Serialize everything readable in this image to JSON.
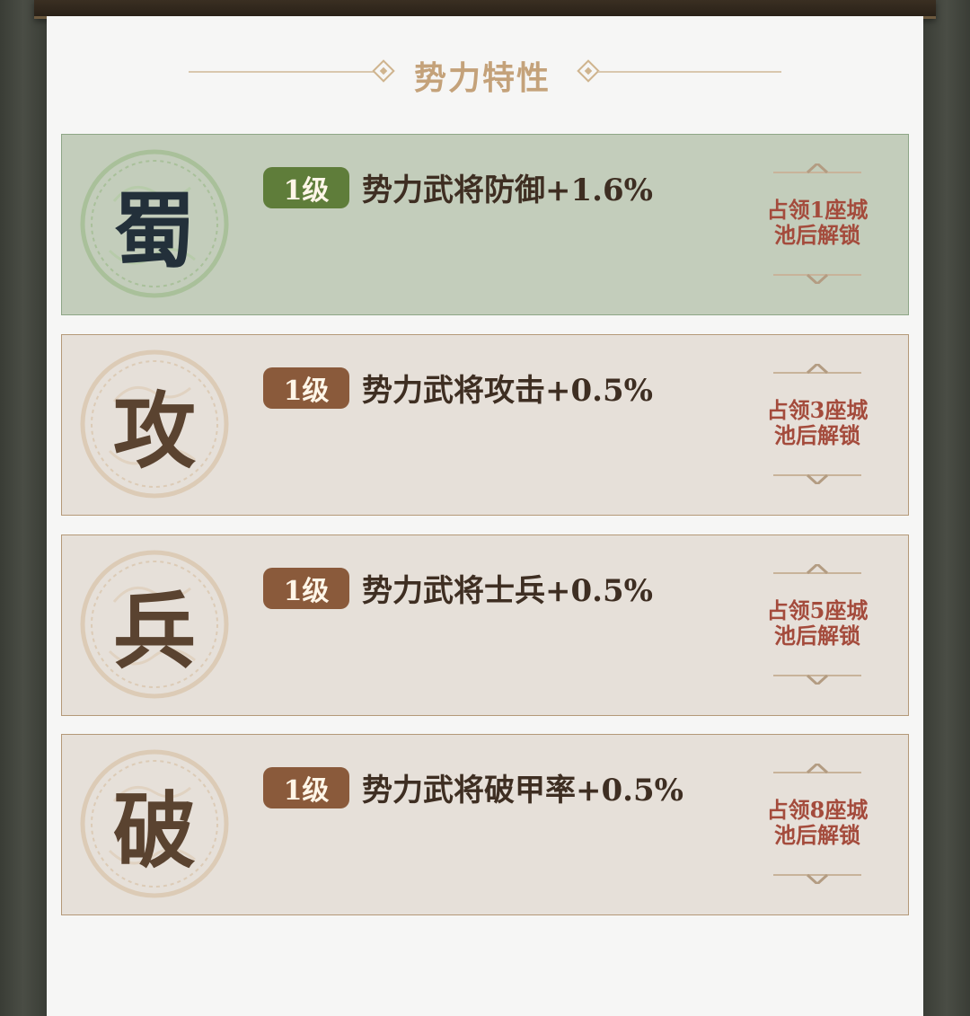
{
  "header": {
    "title": "势力特性"
  },
  "cards": [
    {
      "seal_char": "蜀",
      "level": "1级",
      "effect": "势力武将防御+1.6%",
      "unlock_line1": "占领1座城",
      "unlock_line2": "池后解锁",
      "active": true
    },
    {
      "seal_char": "攻",
      "level": "1级",
      "effect": "势力武将攻击+0.5%",
      "unlock_line1": "占领3座城",
      "unlock_line2": "池后解锁",
      "active": false
    },
    {
      "seal_char": "兵",
      "level": "1级",
      "effect": "势力武将士兵+0.5%",
      "unlock_line1": "占领5座城",
      "unlock_line2": "池后解锁",
      "active": false
    },
    {
      "seal_char": "破",
      "level": "1级",
      "effect": "势力武将破甲率+0.5%",
      "unlock_line1": "占领8座城",
      "unlock_line2": "池后解锁",
      "active": false
    }
  ],
  "colors": {
    "active_card": "#c3cdbb",
    "inactive_card": "#e6e0d9",
    "active_badge": "#5f7d3a",
    "inactive_badge": "#8a5a3b",
    "unlock_text": "#a44b3c",
    "title_gold": "#c4a27a"
  }
}
